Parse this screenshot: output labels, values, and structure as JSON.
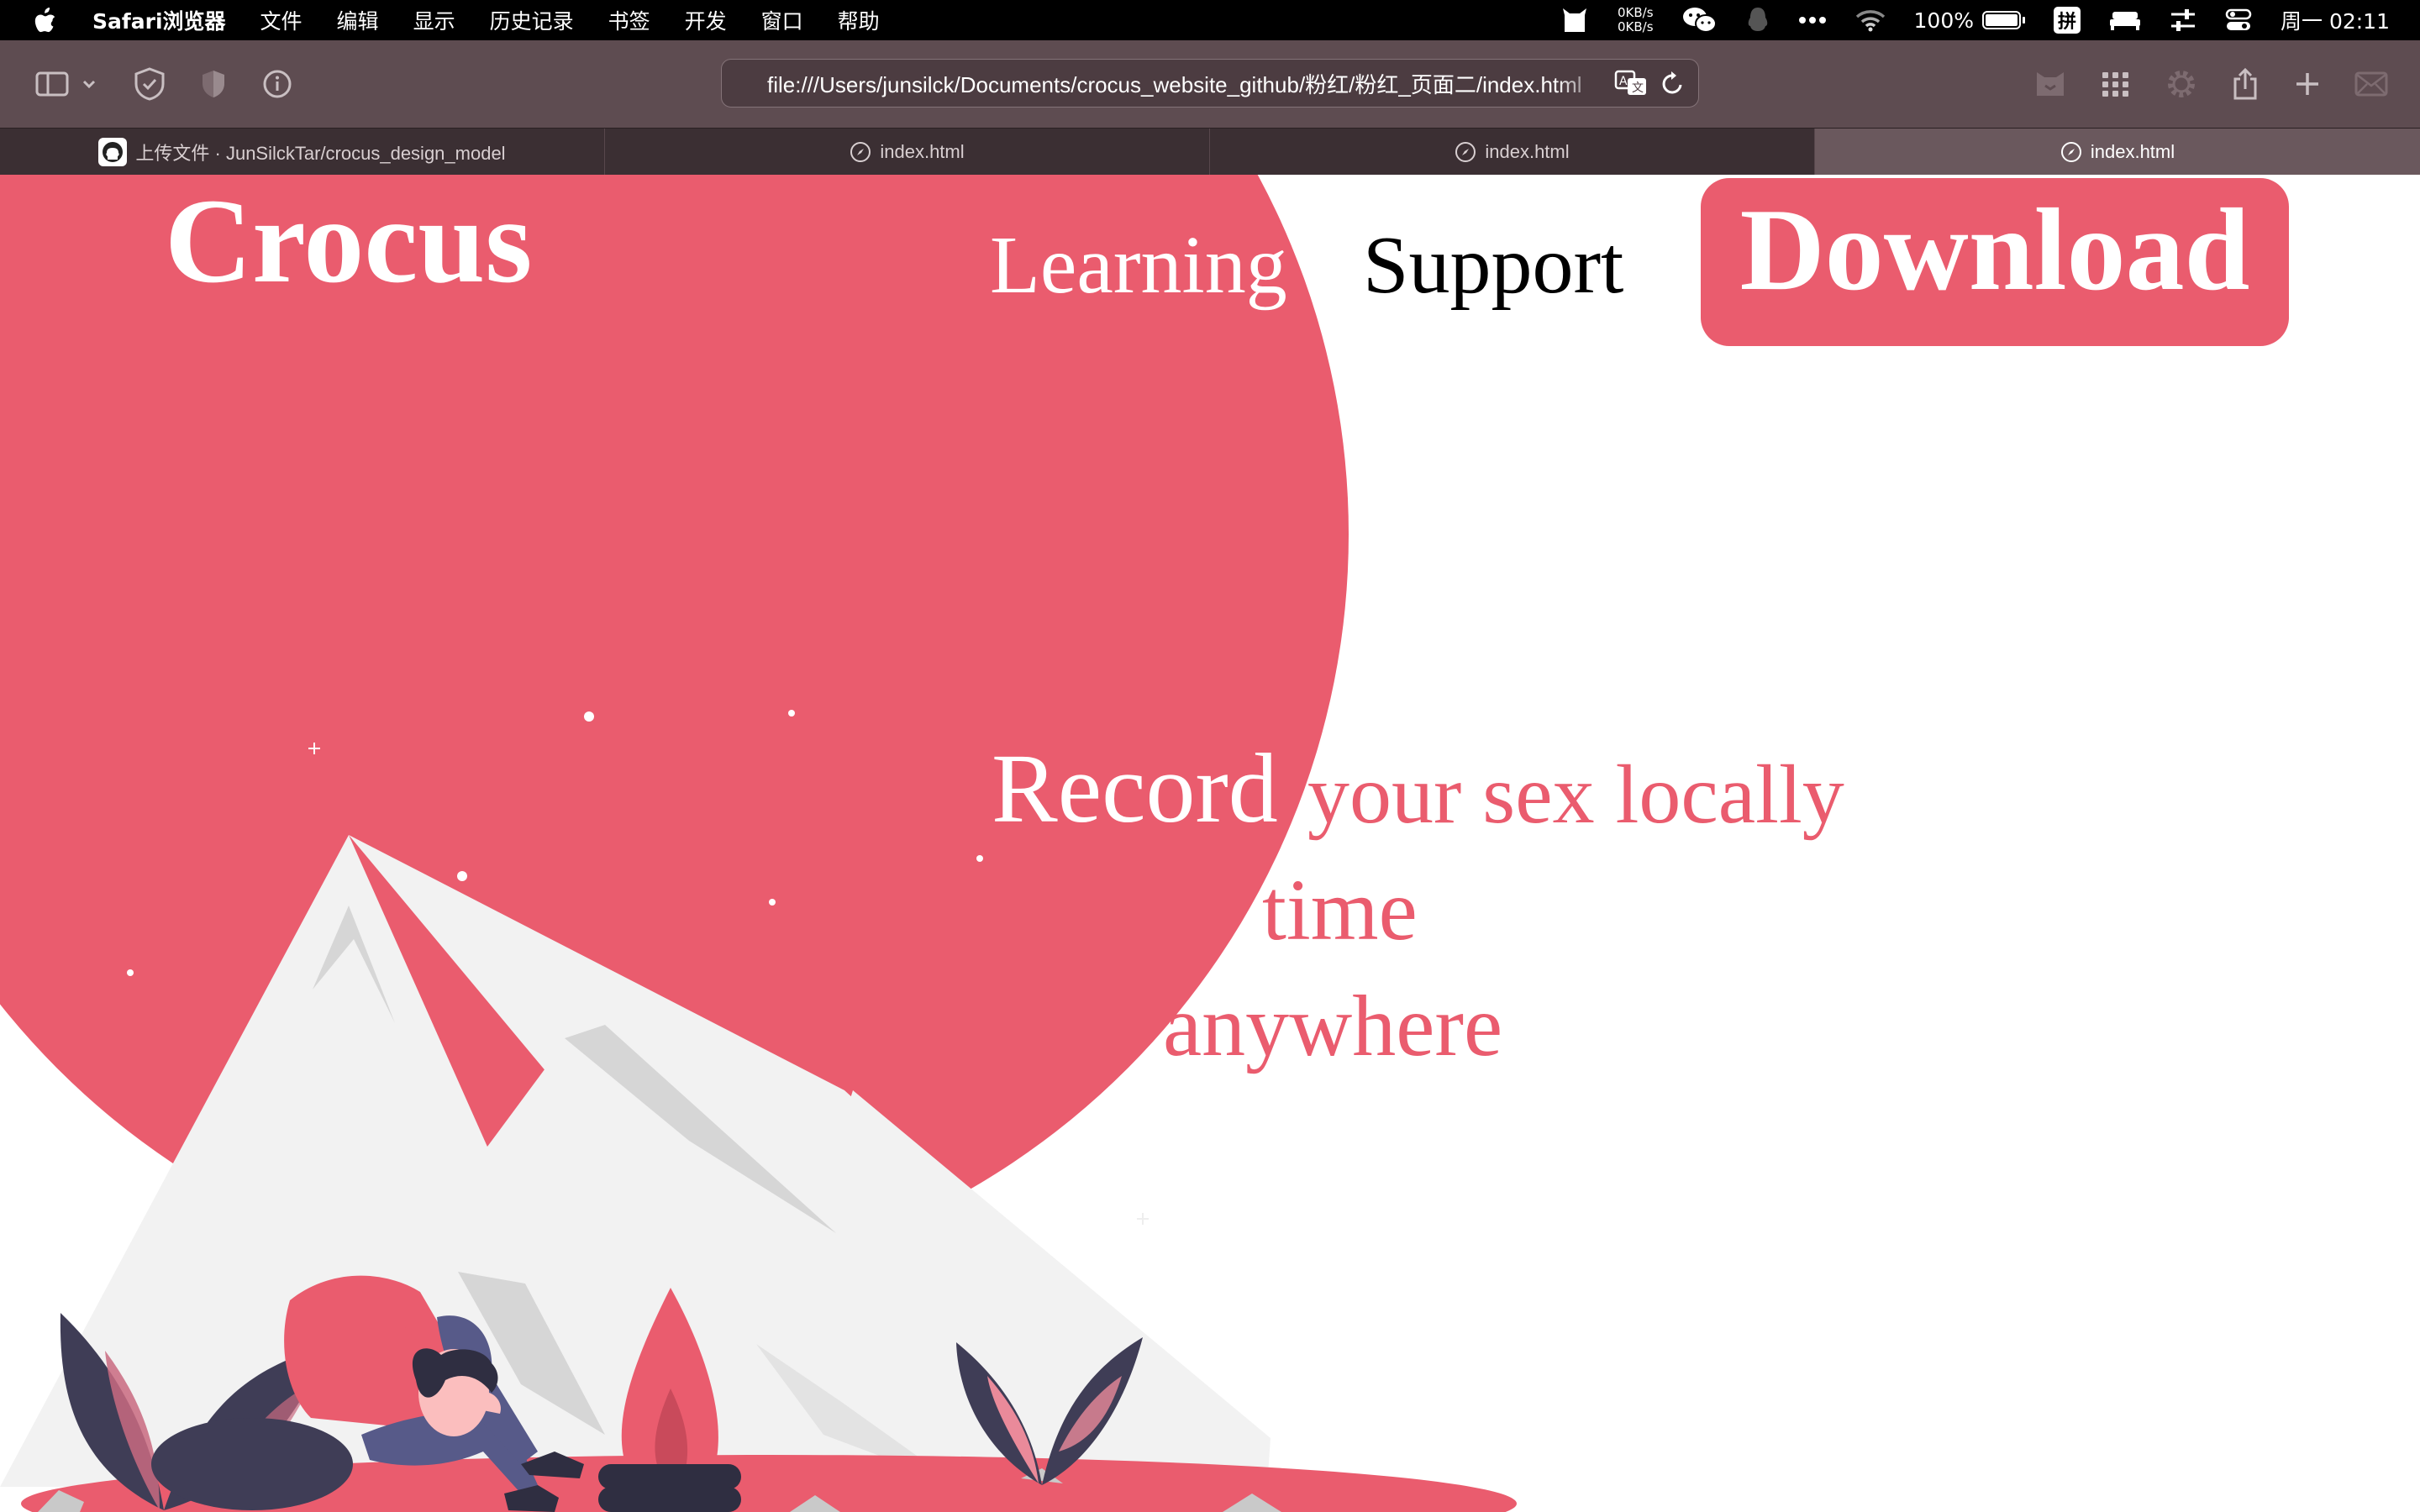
{
  "menubar": {
    "app_name": "Safari浏览器",
    "menus": [
      "文件",
      "编辑",
      "显示",
      "历史记录",
      "书签",
      "开发",
      "窗口",
      "帮助"
    ],
    "net_up": "0KB/s",
    "net_down": "0KB/s",
    "battery_pct": "100%",
    "battery_level": 1.0,
    "ime_label": "拼",
    "clock": "周一 02:11"
  },
  "toolbar": {
    "url": "file:///Users/junsilck/Documents/crocus_website_github/粉红/粉红_页面二/index.html"
  },
  "tabs": [
    {
      "label": "上传文件 · JunSilckTar/crocus_design_model",
      "icon": "github-icon"
    },
    {
      "label": "index.html",
      "icon": "compass-icon"
    },
    {
      "label": "index.html",
      "icon": "compass-icon"
    },
    {
      "label": "index.html",
      "icon": "compass-icon",
      "active": true
    }
  ],
  "site": {
    "brand": "Crocus",
    "nav": {
      "learning": "Learning",
      "support": "Support",
      "download": "Download"
    },
    "hero": {
      "record": "Record",
      "line1": "your sex locally",
      "line2": "time",
      "line3": "anywhere"
    }
  },
  "colors": {
    "accent": "#ea5c6e",
    "dark": "#3f3d56",
    "mountain": "#f2f2f2",
    "toolbar": "#5e4c51"
  }
}
